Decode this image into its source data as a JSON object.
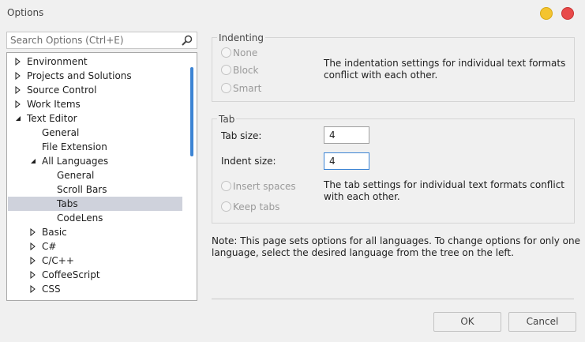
{
  "window": {
    "title": "Options"
  },
  "search": {
    "placeholder": "Search Options (Ctrl+E)"
  },
  "tree": {
    "items": [
      {
        "label": "Environment"
      },
      {
        "label": "Projects and Solutions"
      },
      {
        "label": "Source Control"
      },
      {
        "label": "Work Items"
      },
      {
        "label": "Text Editor"
      },
      {
        "label": "General"
      },
      {
        "label": "File Extension"
      },
      {
        "label": "All Languages"
      },
      {
        "label": "General"
      },
      {
        "label": "Scroll Bars"
      },
      {
        "label": "Tabs"
      },
      {
        "label": "CodeLens"
      },
      {
        "label": "Basic"
      },
      {
        "label": "C#"
      },
      {
        "label": "C/C++"
      },
      {
        "label": "CoffeeScript"
      },
      {
        "label": "CSS"
      }
    ]
  },
  "indenting": {
    "title": "Indenting",
    "options": [
      "None",
      "Block",
      "Smart"
    ],
    "conflict_line1": "The indentation settings for individual text formats",
    "conflict_line2": "conflict with each other."
  },
  "tab": {
    "title": "Tab",
    "tab_size_label": "Tab size:",
    "tab_size_value": "4",
    "indent_size_label": "Indent size:",
    "indent_size_value": "4",
    "insert_spaces_label": "Insert spaces",
    "keep_tabs_label": "Keep tabs",
    "conflict_line1": "The tab settings for individual text formats conflict",
    "conflict_line2": "with each other."
  },
  "note": {
    "line1": "Note: This page sets options for all languages. To change options for only one",
    "line2": "language, select the desired language from the tree on the left."
  },
  "buttons": {
    "ok": "OK",
    "cancel": "Cancel"
  },
  "colors": {
    "selection": "#cfd2dc",
    "accent": "#3c84d4"
  }
}
